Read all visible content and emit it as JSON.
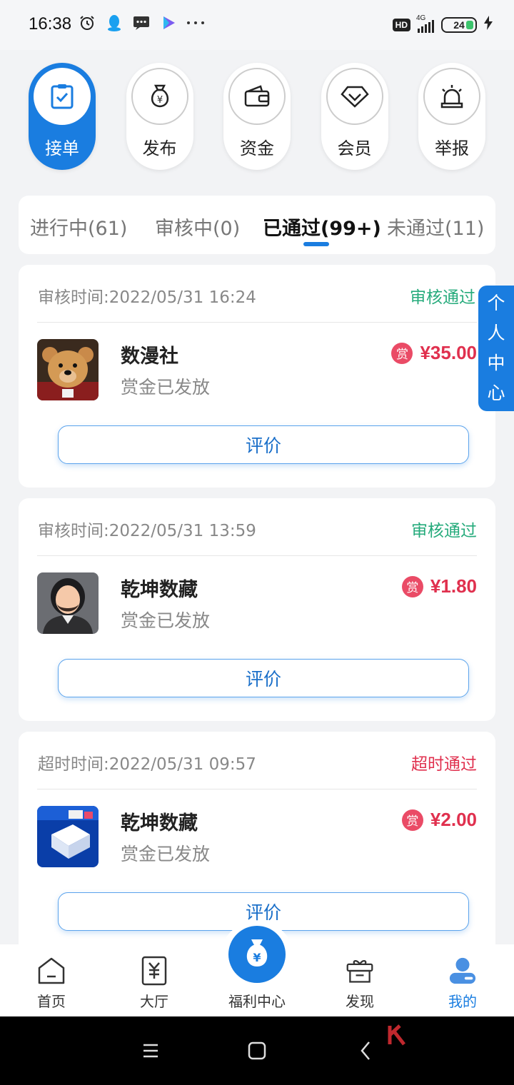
{
  "status_bar": {
    "time": "16:38",
    "hd": "HD",
    "network": "4G",
    "battery": "24"
  },
  "quick_actions": [
    {
      "label": "接单",
      "icon": "clipboard-check-icon",
      "active": true
    },
    {
      "label": "发布",
      "icon": "money-bag-icon",
      "active": false
    },
    {
      "label": "资金",
      "icon": "wallet-icon",
      "active": false
    },
    {
      "label": "会员",
      "icon": "diamond-icon",
      "active": false
    },
    {
      "label": "举报",
      "icon": "alarm-icon",
      "active": false
    }
  ],
  "tabs": [
    {
      "label": "进行中(61)",
      "active": false
    },
    {
      "label": "审核中(0)",
      "active": false
    },
    {
      "label": "已通过(99+)",
      "active": true
    },
    {
      "label": "未通过(11)",
      "active": false
    }
  ],
  "side_tab": {
    "label": [
      "个",
      "人",
      "中",
      "心"
    ]
  },
  "cards": [
    {
      "time_text": "审核时间:2022/05/31 16:24",
      "status": "审核通过",
      "status_color": "#26ab7c",
      "name": "数漫社",
      "sub": "赏金已发放",
      "badge": "赏",
      "amount": "¥35.00",
      "button": "评价",
      "avatar": "teddy-bear-avatar"
    },
    {
      "time_text": "审核时间:2022/05/31 13:59",
      "status": "审核通过",
      "status_color": "#26ab7c",
      "name": "乾坤数藏",
      "sub": "赏金已发放",
      "badge": "赏",
      "amount": "¥1.80",
      "button": "评价",
      "avatar": "bearded-man-avatar"
    },
    {
      "time_text": "超时时间:2022/05/31 09:57",
      "status": "超时通过",
      "status_color": "#e0304e",
      "name": "乾坤数藏",
      "sub": "赏金已发放",
      "badge": "赏",
      "amount": "¥2.00",
      "button": "评价",
      "avatar": "blue-box-avatar"
    }
  ],
  "bottom_nav": [
    {
      "label": "首页",
      "icon": "home-icon",
      "active": false
    },
    {
      "label": "大厅",
      "icon": "yen-receipt-icon",
      "active": false
    },
    {
      "label": "福利中心",
      "icon": "money-bag-icon",
      "active": false
    },
    {
      "label": "发现",
      "icon": "gift-box-icon",
      "active": false
    },
    {
      "label": "我的",
      "icon": "user-icon",
      "active": true
    }
  ],
  "colors": {
    "primary": "#1a7de0",
    "success": "#26ab7c",
    "danger": "#e0304e"
  }
}
